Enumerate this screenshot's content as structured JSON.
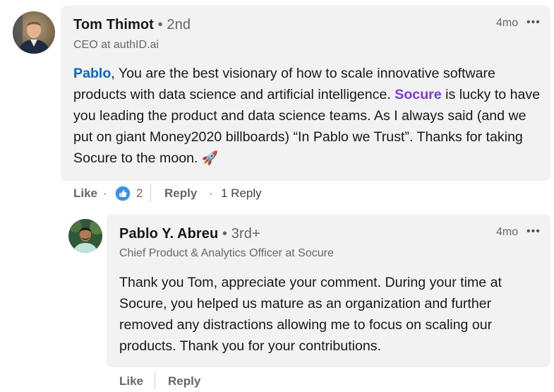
{
  "comment": {
    "author": "Tom Thimot",
    "degree": "• 2nd",
    "headline": "CEO at authID.ai",
    "time": "4mo",
    "more": "•••",
    "mention_1": "Pablo",
    "text_1": ", You are the best visionary of how to scale innovative software products with data science and artificial intelligence. ",
    "mention_2": "Socure",
    "text_2": " is lucky to have you leading the product and data science teams. As I always said (and we put on giant Money2020 billboards) “In Pablo we Trust”. Thanks for taking Socure to the moon. ",
    "emoji": "🚀",
    "like_label": "Like",
    "dot": "·",
    "reaction_count": "2",
    "reply_label": "Reply",
    "replies_label": "1 Reply"
  },
  "reply": {
    "author": "Pablo Y. Abreu",
    "degree": "• 3rd+",
    "headline": "Chief Product & Analytics Officer at Socure",
    "time": "4mo",
    "more": "•••",
    "text": "Thank you Tom, appreciate your comment. During your time at Socure, you helped us mature as an organization and further removed any distractions allowing me to focus on scaling our products. Thank you for your contributions.",
    "like_label": "Like",
    "reply_label": "Reply"
  },
  "colors": {
    "bubble": "#f2f2f2",
    "mention_blue": "#0a66c2",
    "mention_purple": "#7c3bd1",
    "like_blue": "#378fe9"
  },
  "icons": {
    "reaction": "like-thumb-icon",
    "more": "ellipsis-icon"
  }
}
